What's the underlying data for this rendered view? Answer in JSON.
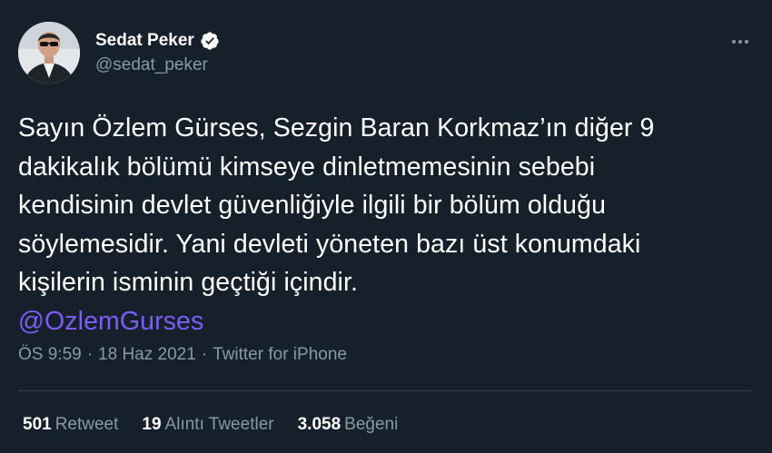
{
  "tweet": {
    "author": {
      "display_name": "Sedat Peker",
      "handle": "@sedat_peker",
      "verified": true
    },
    "text_lines": [
      "Sayın Özlem Gürses, Sezgin Baran Korkmaz’ın diğer 9",
      "dakikalık bölümü kimseye dinletmemesinin sebebi",
      "kendisinin devlet güvenliğiyle ilgili bir bölüm olduğu",
      "söylemesidir. Yani devleti yöneten bazı üst konumdaki",
      "kişilerin isminin geçtiği içindir."
    ],
    "mention": "@OzlemGurses",
    "meta": {
      "time": "ÖS 9:59",
      "separator": "·",
      "date": "18 Haz 2021",
      "source": "Twitter for iPhone"
    },
    "stats": {
      "retweets": {
        "count": "501",
        "label": "Retweet"
      },
      "quotes": {
        "count": "19",
        "label": "Alıntı Tweetler"
      },
      "likes": {
        "count": "3.058",
        "label": "Beğeni"
      }
    }
  },
  "colors": {
    "background": "#15202b",
    "secondary_text": "#8899a6",
    "mention": "#7c5cff",
    "divider": "#38444d"
  },
  "icons": {
    "verified": "verified-badge-icon",
    "more": "more-options-icon"
  }
}
